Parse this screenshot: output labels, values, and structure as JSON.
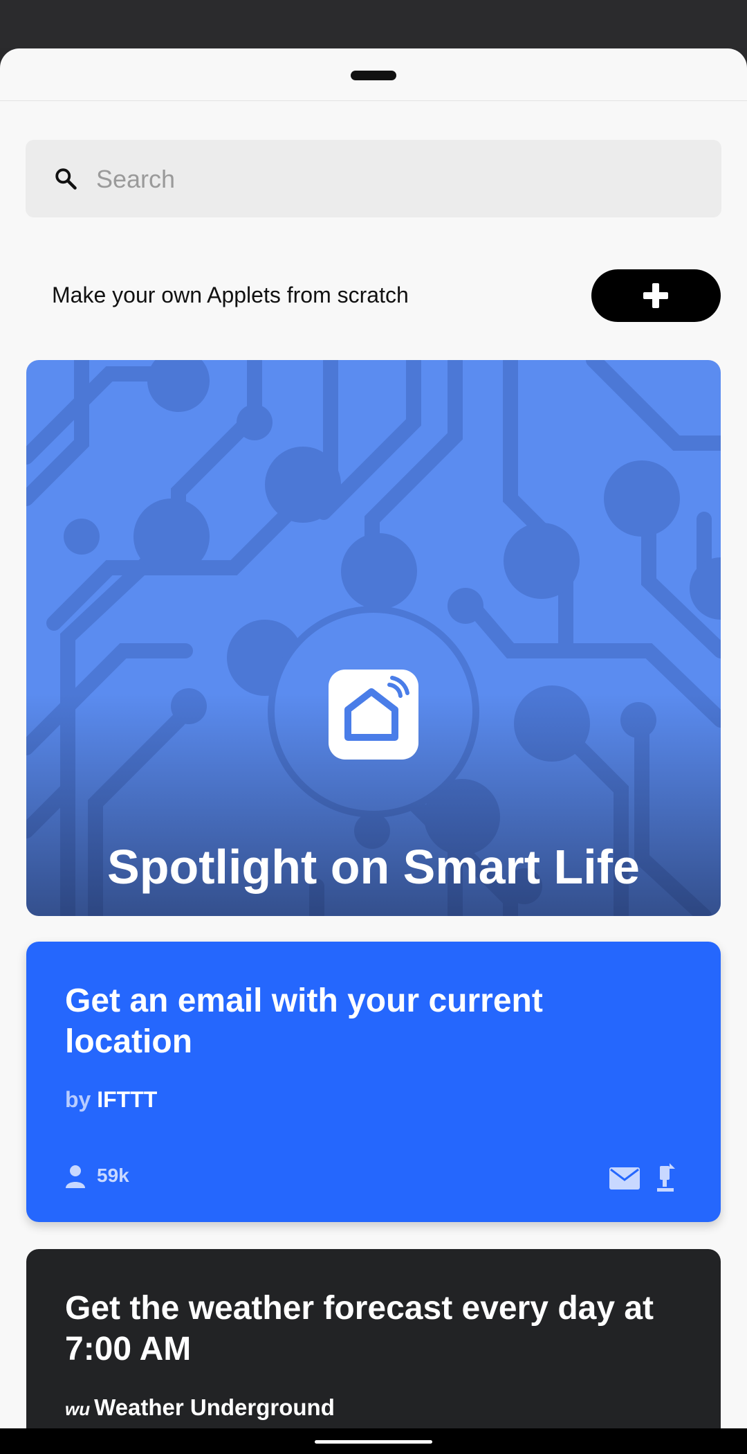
{
  "search": {
    "placeholder": "Search"
  },
  "create": {
    "label": "Make your own Applets from scratch"
  },
  "spotlight": {
    "title": "Spotlight on Smart Life"
  },
  "applets": [
    {
      "title": "Get an email with your current location",
      "by_prefix": "by",
      "author": "IFTTT",
      "users": "59k",
      "services": [
        "mail-icon",
        "location-icon"
      ],
      "color": "#2567fd"
    },
    {
      "title": "Get the weather forecast every day at 7:00 AM",
      "service_icon_text": "wu",
      "service": "Weather Underground",
      "color": "#222325"
    }
  ],
  "colors": {
    "accent": "#2567fd",
    "spotlight_bg": "#5b8cf0",
    "dark_card": "#222325"
  }
}
